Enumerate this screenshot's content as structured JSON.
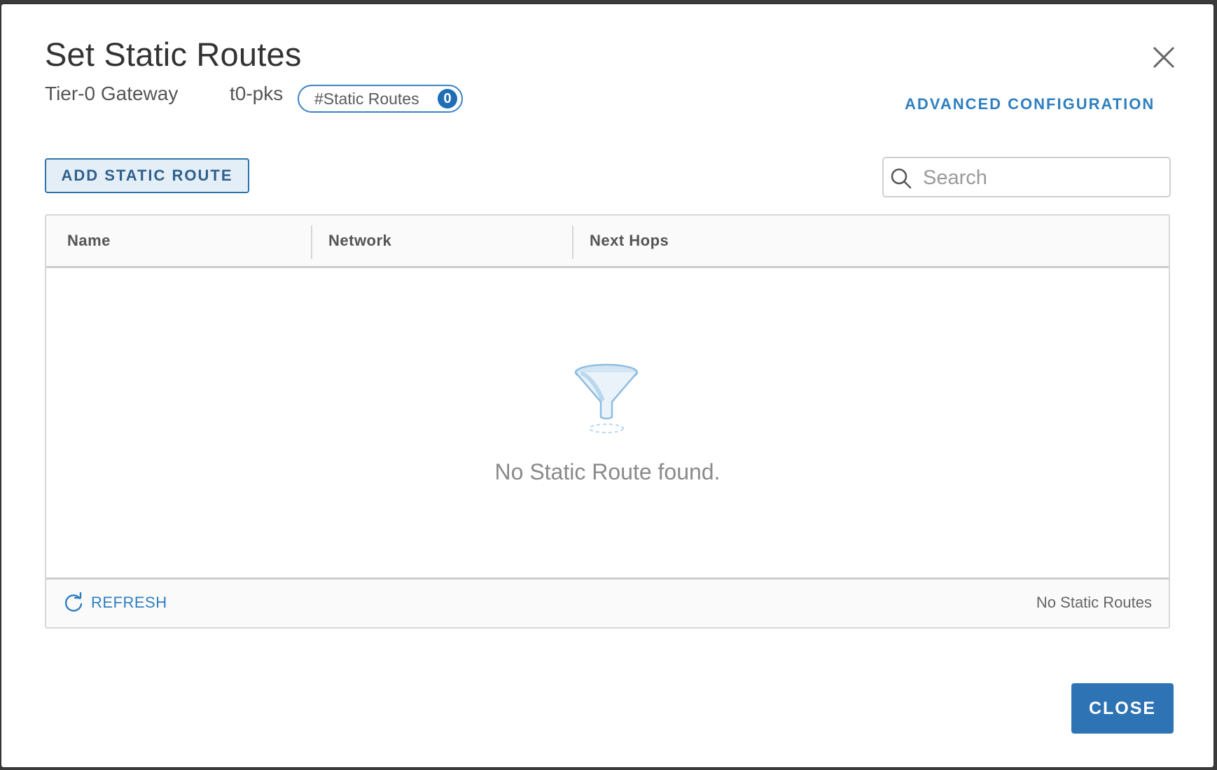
{
  "dialog": {
    "title": "Set Static Routes",
    "gateway_label": "Tier-0 Gateway",
    "gateway_name": "t0-pks",
    "badge_label": "#Static Routes",
    "badge_count": "0",
    "advanced_link": "ADVANCED CONFIGURATION",
    "close_icon": "close-icon"
  },
  "toolbar": {
    "add_label": "ADD STATIC ROUTE",
    "search_placeholder": "Search",
    "search_value": "",
    "search_icon": "search-icon"
  },
  "table": {
    "columns": [
      "Name",
      "Network",
      "Next Hops"
    ],
    "rows": [],
    "empty_icon": "filter-funnel-icon",
    "empty_message": "No Static Route found."
  },
  "footer": {
    "refresh_label": "REFRESH",
    "refresh_icon": "refresh-icon",
    "count_text": "No Static Routes"
  },
  "actions": {
    "close_label": "CLOSE"
  },
  "colors": {
    "accent": "#2e74b5",
    "link": "#2f7fc0",
    "badge": "#1f6eb5",
    "muted_text": "#8a8a8a"
  }
}
